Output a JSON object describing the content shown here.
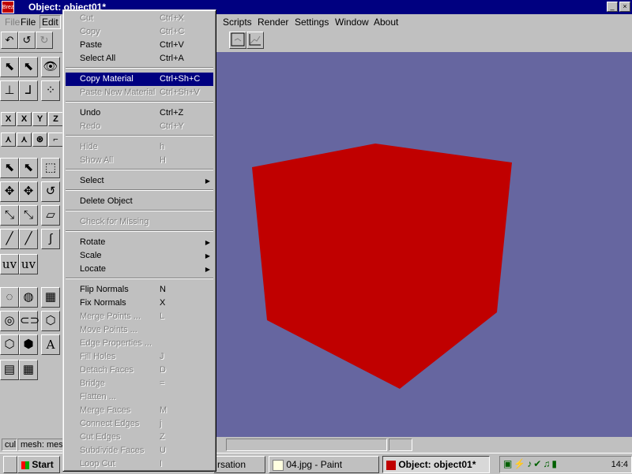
{
  "window": {
    "title": "Object: object01*",
    "app_icon_text": "Brez",
    "minimize": "_",
    "maximize": "□",
    "close": "×"
  },
  "menubar": {
    "items": [
      {
        "label": "File",
        "state": "disabled"
      },
      {
        "label": "File"
      },
      {
        "label": "Edit",
        "state": "open"
      },
      {
        "label": "Scripts"
      },
      {
        "label": "Render"
      },
      {
        "label": "Settings"
      },
      {
        "label": "Window"
      },
      {
        "label": "About"
      }
    ]
  },
  "edit_menu": {
    "items": [
      {
        "label": "Cut",
        "shortcut": "Ctrl+X",
        "disabled": true
      },
      {
        "label": "Copy",
        "shortcut": "Ctrl+C",
        "disabled": true
      },
      {
        "label": "Paste",
        "shortcut": "Ctrl+V"
      },
      {
        "label": "Select All",
        "shortcut": "Ctrl+A"
      },
      {
        "label": "Copy Material",
        "shortcut": "Ctrl+Sh+C",
        "highlighted": true
      },
      {
        "label": "Paste New Material",
        "shortcut": "Ctrl+Sh+V",
        "disabled": true
      },
      {
        "label": "Undo",
        "shortcut": "Ctrl+Z"
      },
      {
        "label": "Redo",
        "shortcut": "Ctrl+Y",
        "disabled": true
      },
      {
        "label": "Hide",
        "shortcut": "h",
        "disabled": true
      },
      {
        "label": "Show All",
        "shortcut": "H",
        "disabled": true
      },
      {
        "label": "Select",
        "submenu": true
      },
      {
        "label": "Delete Object"
      },
      {
        "label": "Check for Missing",
        "disabled": true
      },
      {
        "label": "Rotate",
        "submenu": true
      },
      {
        "label": "Scale",
        "submenu": true
      },
      {
        "label": "Locate",
        "submenu": true
      },
      {
        "label": "Flip Normals",
        "shortcut": "N"
      },
      {
        "label": "Fix Normals",
        "shortcut": "X"
      },
      {
        "label": "Merge Points ...",
        "shortcut": "L",
        "disabled": true
      },
      {
        "label": "Move Points ...",
        "disabled": true
      },
      {
        "label": "Edge Properties ...",
        "disabled": true
      },
      {
        "label": "Fill Holes",
        "shortcut": "J",
        "disabled": true
      },
      {
        "label": "Detach Faces",
        "shortcut": "D",
        "disabled": true
      },
      {
        "label": "Bridge",
        "shortcut": "=",
        "disabled": true
      },
      {
        "label": "Flatten ...",
        "disabled": true
      },
      {
        "label": "Merge Faces",
        "shortcut": "M",
        "disabled": true
      },
      {
        "label": "Connect Edges",
        "shortcut": "j",
        "disabled": true
      },
      {
        "label": "Cut Edges",
        "shortcut": "Z",
        "disabled": true
      },
      {
        "label": "Subdivide Faces",
        "shortcut": "U",
        "disabled": true
      },
      {
        "label": "Loop Cut",
        "shortcut": "I",
        "disabled": true
      }
    ],
    "submenu_arrow": "▶"
  },
  "palette": {
    "axis_x": "X",
    "axis_x2": "X",
    "axis_y": "Y",
    "axis_z": "Z",
    "uv1": "uv",
    "uv2": "uv",
    "text_tool": "A"
  },
  "status": {
    "field1": "cul",
    "field2": "mesh: mes"
  },
  "taskbar": {
    "start": "Start",
    "tasks": [
      {
        "label": "rsation"
      },
      {
        "label": "04.jpg - Paint"
      },
      {
        "label": "Object: object01*",
        "active": true
      }
    ],
    "clock": "14:4"
  },
  "colors": {
    "viewport_bg": "#6666a0",
    "cube": "#c00000",
    "highlight": "#000080"
  }
}
